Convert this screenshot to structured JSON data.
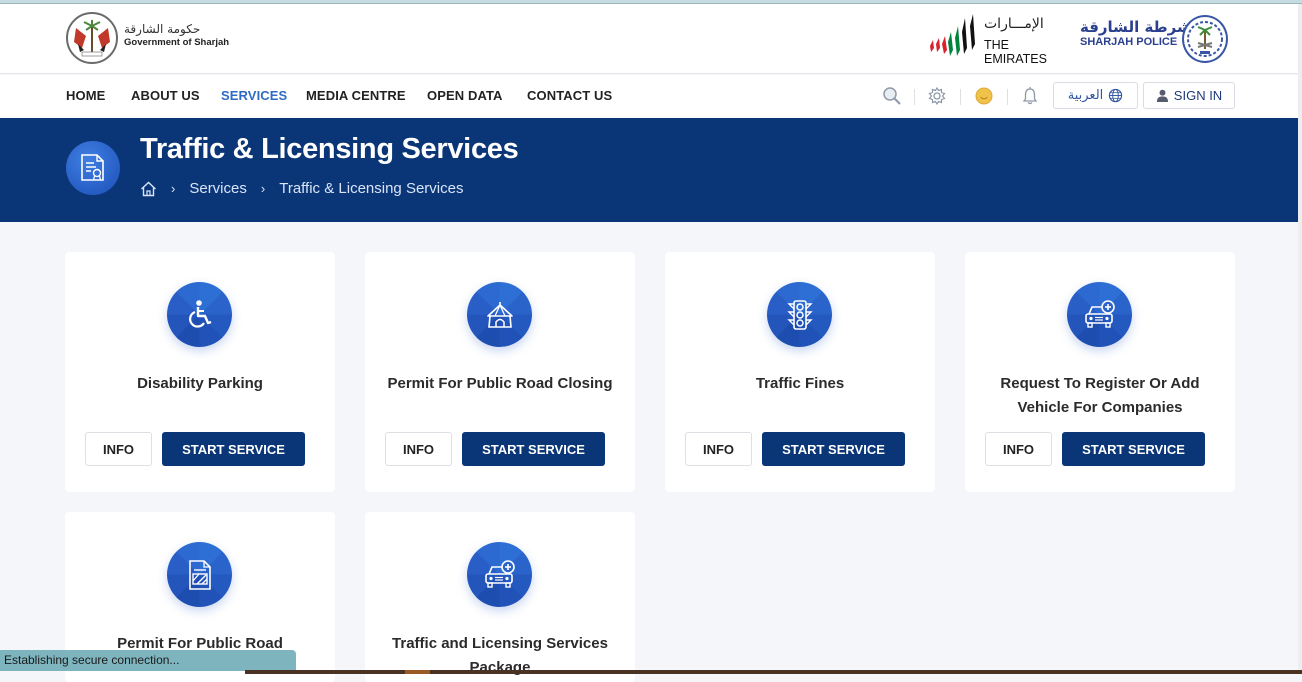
{
  "header": {
    "gov_logo_ar": "حكومة الشارقة",
    "gov_logo_en": "Government of Sharjah",
    "emirates_ar": "الإمـــارات",
    "emirates_en": "THE EMIRATES",
    "police_ar": "شرطة الشارقة",
    "police_en": "SHARJAH POLICE"
  },
  "nav": {
    "items": [
      {
        "label": "HOME"
      },
      {
        "label": "ABOUT US"
      },
      {
        "label": "SERVICES",
        "active": true
      },
      {
        "label": "MEDIA CENTRE"
      },
      {
        "label": "OPEN DATA"
      },
      {
        "label": "CONTACT US"
      }
    ],
    "icons": [
      "search-icon",
      "settings-icon",
      "smiley-icon",
      "bell-icon"
    ],
    "language_label": "العربية",
    "signin_label": "SIGN IN"
  },
  "banner": {
    "title": "Traffic & Licensing Services",
    "breadcrumb": [
      "Services",
      "Traffic & Licensing Services"
    ]
  },
  "services": [
    {
      "title": "Disability Parking",
      "icon": "wheelchair-icon",
      "info_label": "INFO",
      "start_label": "START SERVICE"
    },
    {
      "title": "Permit For Public Road Closing",
      "icon": "tent-icon",
      "info_label": "INFO",
      "start_label": "START SERVICE"
    },
    {
      "title": "Traffic Fines",
      "icon": "traffic-light-icon",
      "info_label": "INFO",
      "start_label": "START SERVICE"
    },
    {
      "title": "Request To Register Or Add Vehicle For Companies",
      "icon": "car-add-icon",
      "info_label": "INFO",
      "start_label": "START SERVICE"
    },
    {
      "title": "Permit For Public Road",
      "icon": "document-barrier-icon"
    },
    {
      "title": "Traffic and Licensing Services Package",
      "icon": "car-add-icon"
    }
  ],
  "colors": {
    "primary": "#0a3678",
    "accent": "#2f6bc4",
    "background": "#f4f6fa"
  },
  "status_bar": "Establishing secure connection..."
}
